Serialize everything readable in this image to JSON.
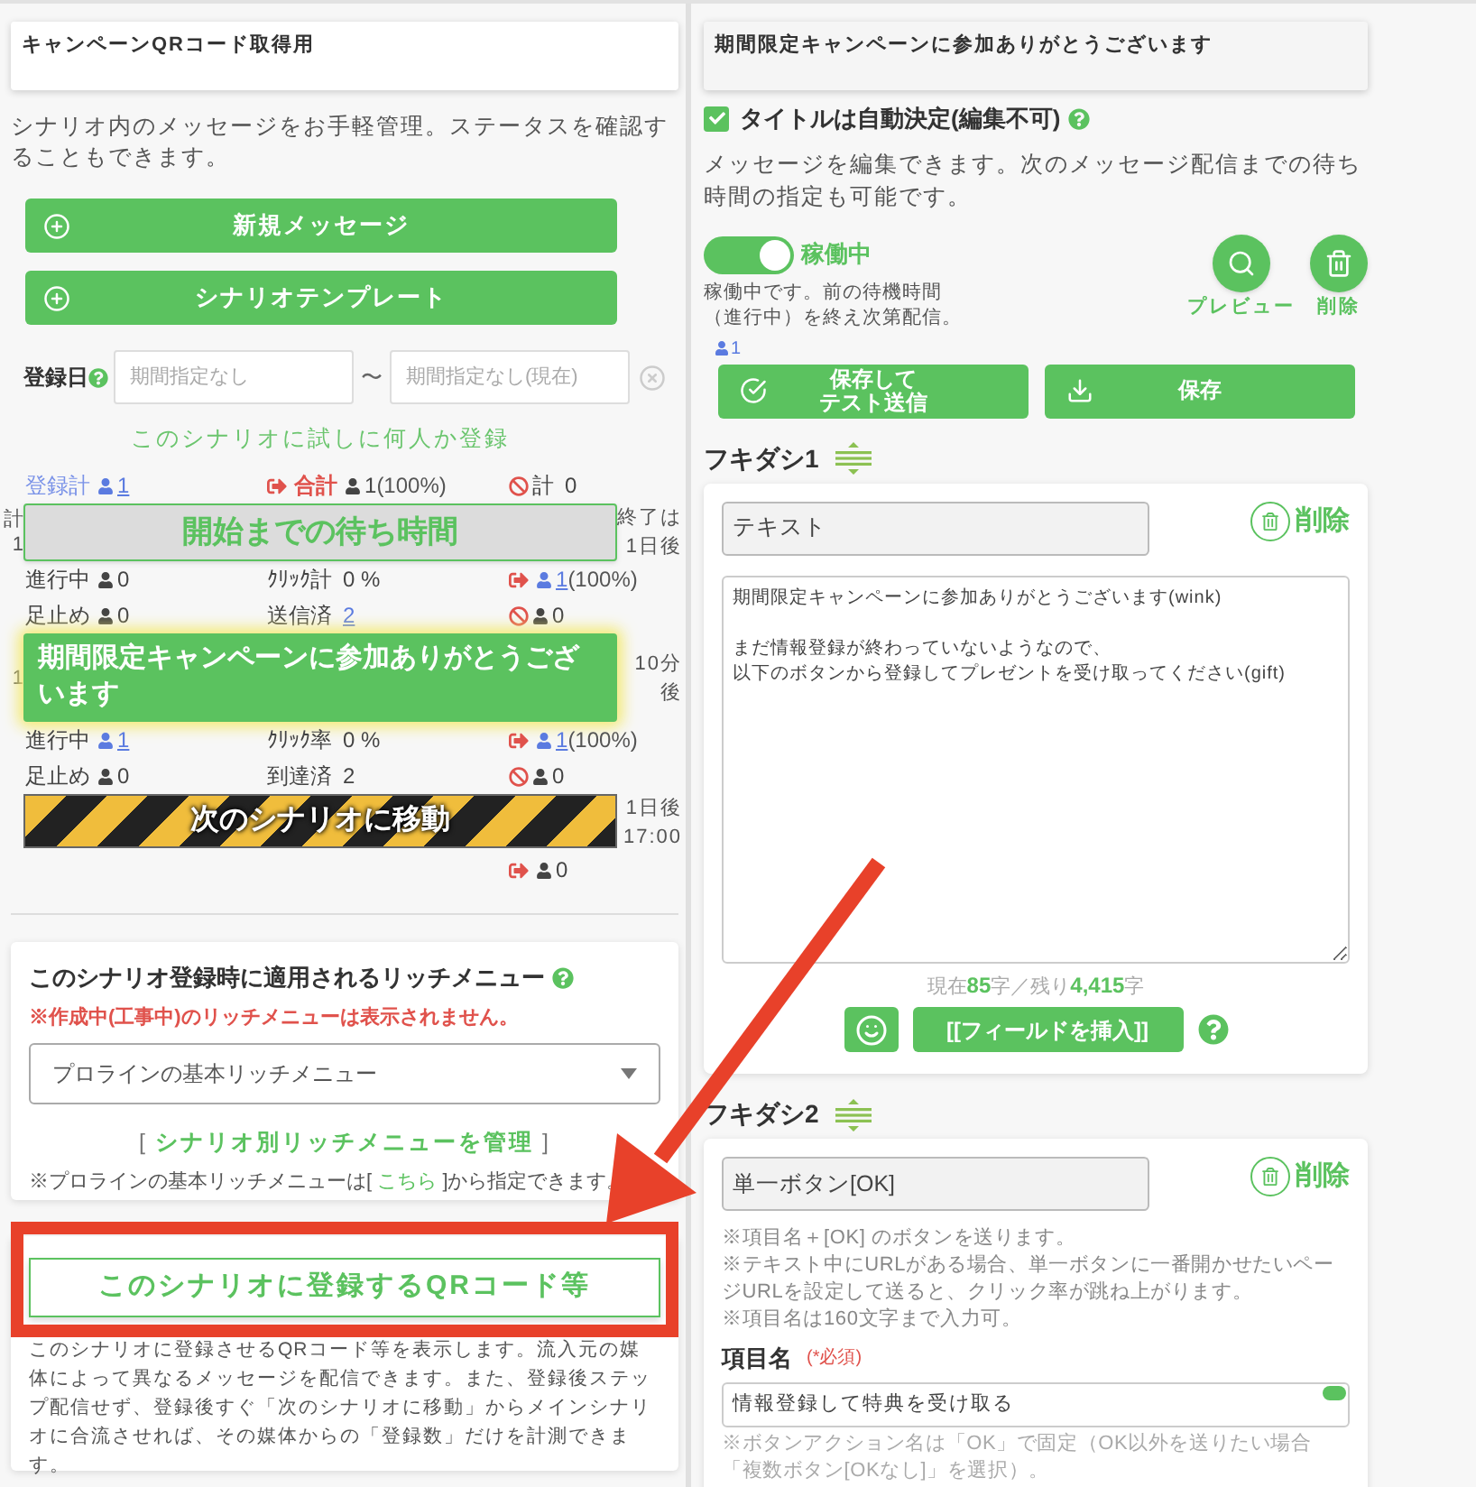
{
  "left": {
    "scenario_title": "キャンペーンQRコード取得用",
    "description": "シナリオ内のメッセージをお手軽管理。ステータスを確認することもできます。",
    "action_buttons": [
      {
        "label": "新規メッセージ"
      },
      {
        "label": "シナリオテンプレート"
      }
    ],
    "date_filter": {
      "label": "登録日",
      "from_placeholder": "期間指定なし",
      "separator": "〜",
      "to_placeholder": "期間指定なし(現在)"
    },
    "trial_link": "このシナリオに試しに何人か登録",
    "timeline": [
      {
        "kind": "stats",
        "cells": [
          {
            "kind": "count",
            "label": "登録計",
            "label_link": true,
            "person": true,
            "value": "1",
            "linked": true
          },
          {
            "kind": "exit",
            "label": "合計",
            "person": true,
            "value": "1",
            "linked": false,
            "suffix": "(100%)"
          },
          {
            "kind": "block",
            "label": "計",
            "value": "0",
            "linked": false
          }
        ]
      },
      {
        "kind": "wait",
        "label": "開始までの待ち時間",
        "left_note": [
          "計",
          "1"
        ],
        "right_note": [
          "終了は",
          "1日後"
        ]
      },
      {
        "kind": "stats",
        "cells": [
          {
            "kind": "count",
            "label": "進行中",
            "person": true,
            "value": "0",
            "linked": false
          },
          {
            "kind": "count",
            "label": "ｸﾘｯｸ計",
            "value": "0 %",
            "linked": false
          },
          {
            "kind": "exit",
            "person": true,
            "value": "1",
            "linked": true,
            "suffix": "(100%)"
          }
        ]
      },
      {
        "kind": "stats",
        "cells": [
          {
            "kind": "count",
            "label": "足止め",
            "person": true,
            "value": "0",
            "linked": false
          },
          {
            "kind": "count",
            "label": "送信済",
            "value": "2",
            "linked": true
          },
          {
            "kind": "block",
            "person": true,
            "value": "0",
            "linked": false
          }
        ]
      },
      {
        "kind": "message",
        "label": "期間限定キャンペーンに参加ありがとうございます",
        "selected": true,
        "left_note": [
          "1"
        ],
        "right_note": [
          "10分",
          "後"
        ]
      },
      {
        "kind": "stats",
        "cells": [
          {
            "kind": "count",
            "label": "進行中",
            "person": true,
            "value": "1",
            "linked": true
          },
          {
            "kind": "count",
            "label": "ｸﾘｯｸ率",
            "value": "0 %",
            "linked": false
          },
          {
            "kind": "exit",
            "person": true,
            "value": "1",
            "linked": true,
            "suffix": "(100%)"
          }
        ]
      },
      {
        "kind": "stats",
        "cells": [
          {
            "kind": "count",
            "label": "足止め",
            "person": true,
            "value": "0",
            "linked": false
          },
          {
            "kind": "count",
            "label": "到達済",
            "value": "2",
            "linked": false
          },
          {
            "kind": "block",
            "person": true,
            "value": "0",
            "linked": false
          }
        ]
      },
      {
        "kind": "move",
        "label": "次のシナリオに移動",
        "right_note": [
          "1日後",
          "17:00"
        ]
      },
      {
        "kind": "stats",
        "cells": [
          null,
          null,
          {
            "kind": "exit",
            "person": true,
            "value": "0",
            "linked": false
          }
        ]
      }
    ],
    "rich_menu": {
      "title": "このシナリオ登録時に適用されるリッチメニュー",
      "warning": "※作成中(工事中)のリッチメニューは表示されません。",
      "selected_menu": "プロラインの基本リッチメニュー",
      "manage_link": {
        "open": "[",
        "label": "シナリオ別リッチメニューを管理",
        "close": "]"
      },
      "note": {
        "before": "※プロラインの基本リッチメニューは[",
        "link": "こちら",
        "after": "]から指定できます。"
      }
    },
    "qr": {
      "button": "このシナリオに登録するQRコード等",
      "description": "このシナリオに登録させるQRコード等を表示します。流入元の媒体によって異なるメッセージを配信できます。また、登録後ステップ配信せず、登録後すぐ「次のシナリオに移動」からメインシナリオに合流させれば、その媒体からの「登録数」だけを計測できます。"
    }
  },
  "editor": {
    "title": "期間限定キャンペーンに参加ありがとうございます",
    "auto_title": {
      "label": "タイトルは自動決定(編集不可)",
      "checked": true
    },
    "description": "メッセージを編集できます。次のメッセージ配信までの待ち時間の指定も可能です。",
    "status": {
      "on": true,
      "label": "稼働中",
      "note_lines": [
        "稼働中です。前の待機時間",
        "（進行中）を終え次第配信。"
      ]
    },
    "round_actions": [
      {
        "kind": "preview",
        "label": "プレビュー"
      },
      {
        "kind": "delete",
        "label": "削除"
      }
    ],
    "recipients": "1",
    "save_buttons": [
      {
        "kind": "test",
        "label_lines": [
          "保存して",
          "テスト送信"
        ]
      },
      {
        "kind": "save",
        "label_lines": [
          "保存"
        ]
      }
    ],
    "bubbles": [
      {
        "kind": "text",
        "heading": "フキダシ1",
        "type_value": "テキスト",
        "delete_label": "削除",
        "body_paragraphs": [
          {
            "lines": [
              "期間限定キャンペーンに参加ありがとうございます(wink)"
            ]
          },
          {
            "lines": [
              "まだ情報登録が終わっていないようなので、",
              "以下のボタンから登録してプレゼントを受け取ってください(gift)"
            ]
          }
        ],
        "counter": {
          "current_label": "現在",
          "current_value": "85",
          "current_unit": "字",
          "separator": "／",
          "remaining_label": "残り",
          "remaining_value": "4,415",
          "remaining_unit": "字"
        },
        "insert_field": "[[フィールドを挿入]]"
      },
      {
        "kind": "button",
        "heading": "フキダシ2",
        "type_value": "単一ボタン[OK]",
        "delete_label": "削除",
        "notes": [
          "※項目名＋[OK] のボタンを送ります。",
          "※テキスト中にURLがある場合、単一ボタンに一番開かせたいページURLを設定して送ると、クリック率が跳ね上がります。",
          "※項目名は160文字まで入力可。"
        ],
        "item_label": "項目名",
        "required": "(*必須)",
        "item_value": "情報登録して特典を受け取る",
        "footnote": "※ボタンアクション名は「OK」で固定（OK以外を送りたい場合「複数ボタン[OKなし]」を選択）。"
      }
    ]
  }
}
